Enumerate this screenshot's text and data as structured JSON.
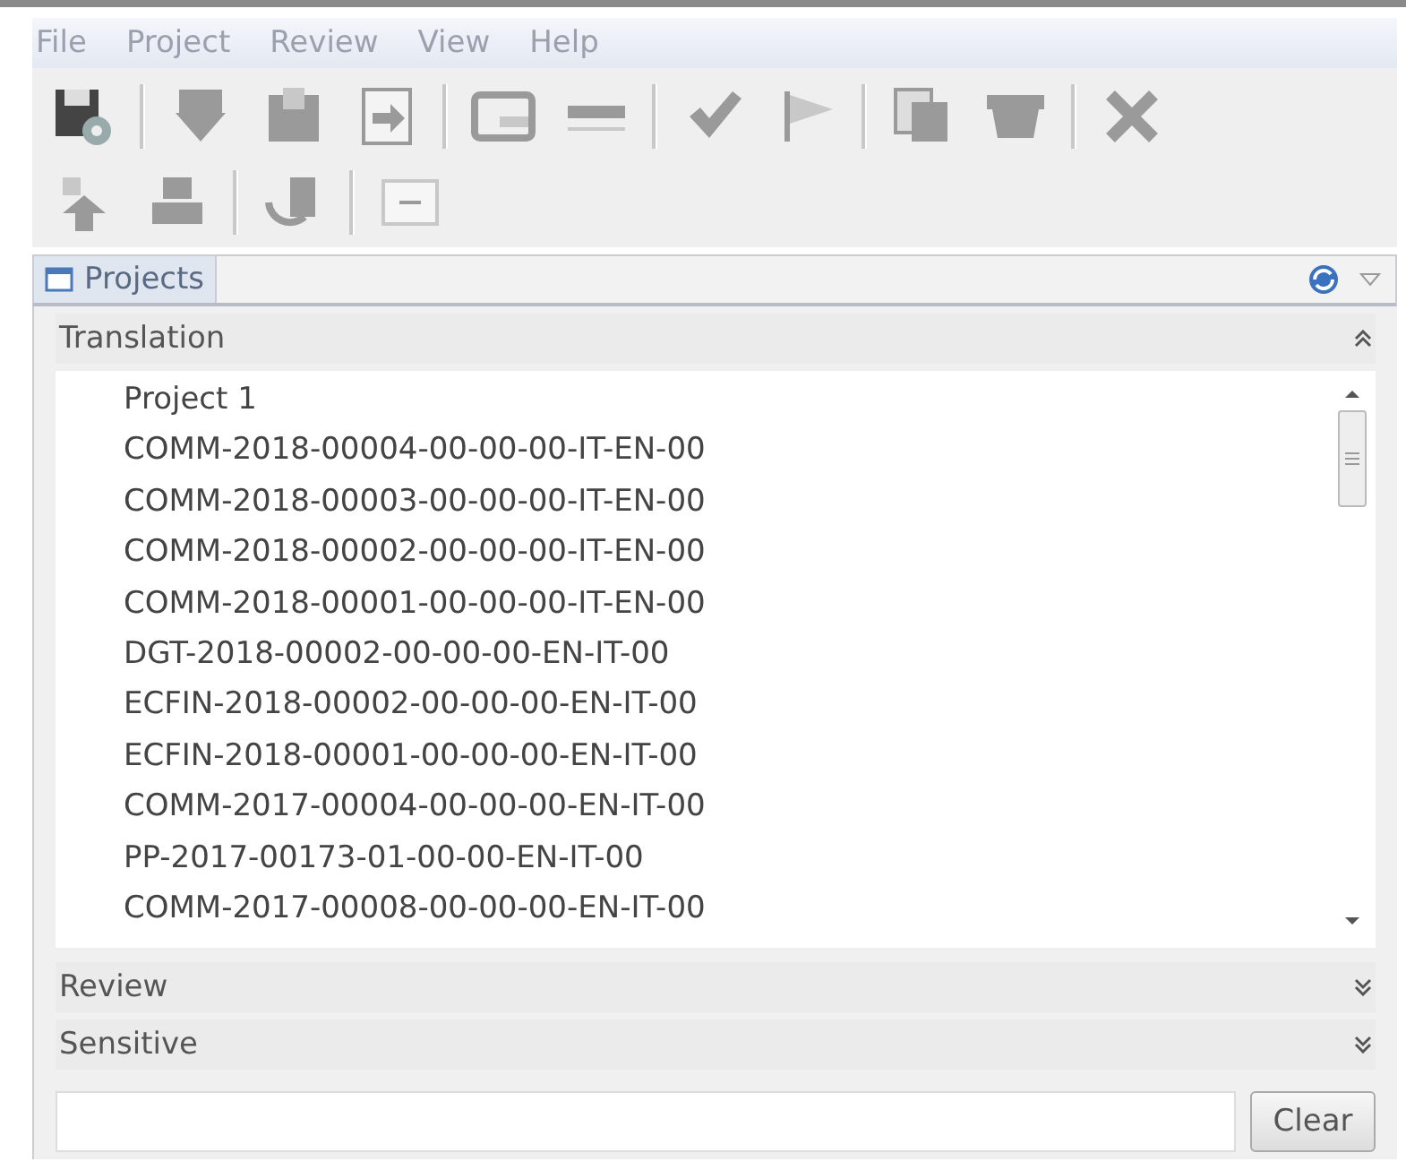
{
  "menu": [
    "File",
    "Project",
    "Review",
    "View",
    "Help"
  ],
  "toolbar": {
    "rows": [
      [
        {
          "kind": "save",
          "disabled": false
        },
        {
          "kind": "separator"
        },
        {
          "kind": "download",
          "disabled": true
        },
        {
          "kind": "package",
          "disabled": true
        },
        {
          "kind": "import",
          "disabled": true
        },
        {
          "kind": "separator"
        },
        {
          "kind": "window",
          "disabled": true
        },
        {
          "kind": "dash",
          "disabled": true
        },
        {
          "kind": "separator"
        },
        {
          "kind": "check",
          "disabled": true
        },
        {
          "kind": "flag",
          "disabled": true
        },
        {
          "kind": "separator"
        },
        {
          "kind": "copy",
          "disabled": true
        },
        {
          "kind": "box",
          "disabled": true
        },
        {
          "kind": "separator"
        },
        {
          "kind": "close",
          "disabled": true
        }
      ],
      [
        {
          "kind": "upload",
          "disabled": true
        },
        {
          "kind": "stack",
          "disabled": true
        },
        {
          "kind": "separator"
        },
        {
          "kind": "refresh",
          "disabled": true
        },
        {
          "kind": "separator"
        },
        {
          "kind": "note",
          "disabled": true
        }
      ]
    ]
  },
  "view": {
    "title": "Projects",
    "selected": true
  },
  "sections": [
    {
      "title": "Translation",
      "expanded": true,
      "items": [
        {
          "label": "Project 1",
          "selected": false
        },
        {
          "label": "COMM-2018-00004-00-00-00-IT-EN-00",
          "selected": false
        },
        {
          "label": "COMM-2018-00003-00-00-00-IT-EN-00",
          "selected": false
        },
        {
          "label": "COMM-2018-00002-00-00-00-IT-EN-00",
          "selected": false
        },
        {
          "label": "COMM-2018-00001-00-00-00-IT-EN-00",
          "selected": false
        },
        {
          "label": "DGT-2018-00002-00-00-00-EN-IT-00",
          "selected": false
        },
        {
          "label": "ECFIN-2018-00002-00-00-00-EN-IT-00",
          "selected": false
        },
        {
          "label": "ECFIN-2018-00001-00-00-00-EN-IT-00",
          "selected": false
        },
        {
          "label": "COMM-2017-00004-00-00-00-EN-IT-00",
          "selected": false
        },
        {
          "label": "PP-2017-00173-01-00-00-EN-IT-00",
          "selected": false
        },
        {
          "label": "COMM-2017-00008-00-00-00-EN-IT-00",
          "selected": false
        }
      ]
    },
    {
      "title": "Review",
      "expanded": false
    },
    {
      "title": "Sensitive",
      "expanded": false
    }
  ],
  "filter": {
    "button": "Clear"
  }
}
